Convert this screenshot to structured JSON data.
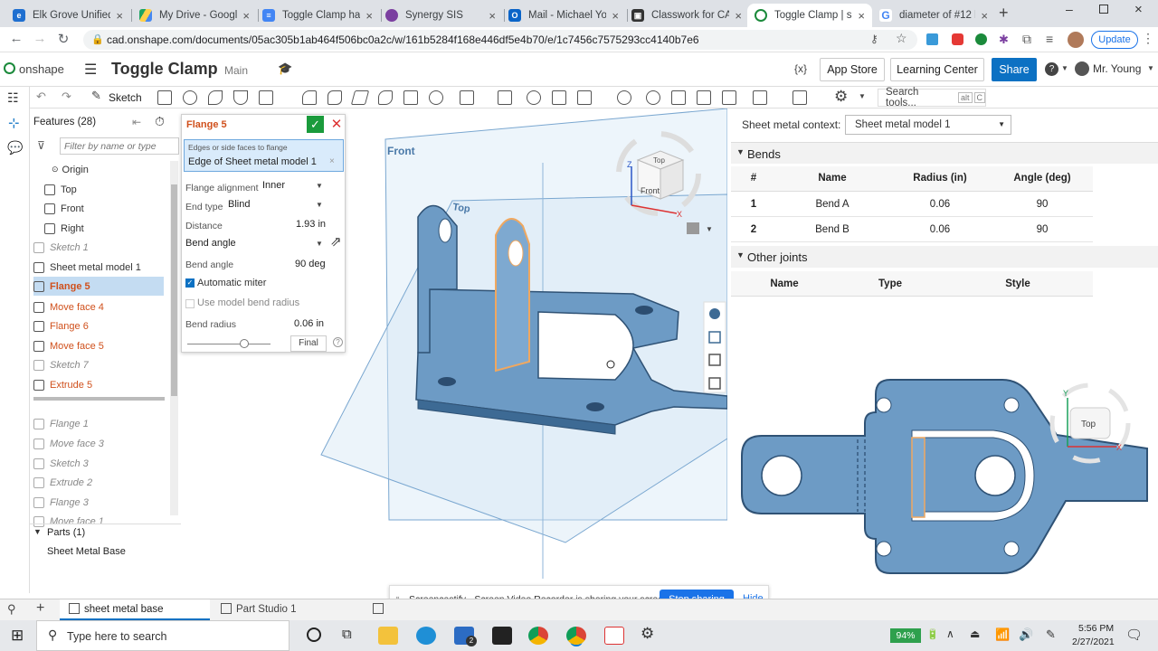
{
  "browser": {
    "tabs": [
      {
        "label": "Elk Grove Unified",
        "icon": "edge-icon"
      },
      {
        "label": "My Drive - Google",
        "icon": "drive-icon"
      },
      {
        "label": "Toggle Clamp har",
        "icon": "docs-icon"
      },
      {
        "label": "Synergy SIS",
        "icon": "synergy-icon"
      },
      {
        "label": "Mail - Michael You",
        "icon": "outlook-icon"
      },
      {
        "label": "Classwork for CAD",
        "icon": "classroom-icon"
      },
      {
        "label": "Toggle Clamp | sh",
        "icon": "onshape-icon"
      },
      {
        "label": "diameter of #12 b",
        "icon": "google-icon"
      }
    ],
    "url": "cad.onshape.com/documents/05ac305b1ab464f506bc0a2c/w/161b5284f168e446df5e4b70/e/1c7456c7575293cc4140b7e6",
    "update_label": "Update"
  },
  "app": {
    "logo": "onshape",
    "doc_title": "Toggle Clamp",
    "branch": "Main",
    "app_store": "App Store",
    "learning_center": "Learning Center",
    "share": "Share",
    "user": "Mr. Young"
  },
  "toolbar": {
    "sketch_label": "Sketch",
    "search_tools": "Search tools...",
    "search_shortcut_1": "alt",
    "search_shortcut_2": "C"
  },
  "features": {
    "header": "Features (28)",
    "filter_placeholder": "Filter by name or type",
    "items": [
      {
        "label": "Origin",
        "style": "normal"
      },
      {
        "label": "Top",
        "style": "normal"
      },
      {
        "label": "Front",
        "style": "normal"
      },
      {
        "label": "Right",
        "style": "normal"
      },
      {
        "label": "Sketch 1",
        "style": "grey"
      },
      {
        "label": "Sheet metal model 1",
        "style": "normal"
      },
      {
        "label": "Flange 5",
        "style": "selected"
      },
      {
        "label": "Move face 4",
        "style": "orange"
      },
      {
        "label": "Flange 6",
        "style": "orange"
      },
      {
        "label": "Move face 5",
        "style": "orange"
      },
      {
        "label": "Sketch 7",
        "style": "grey"
      },
      {
        "label": "Extrude 5",
        "style": "orange"
      },
      {
        "label": "Flange 1",
        "style": "rolled"
      },
      {
        "label": "Move face 3",
        "style": "rolled"
      },
      {
        "label": "Sketch 3",
        "style": "rolled"
      },
      {
        "label": "Extrude 2",
        "style": "rolled"
      },
      {
        "label": "Flange 3",
        "style": "rolled"
      },
      {
        "label": "Move face 1",
        "style": "rolled"
      }
    ],
    "parts_header": "Parts (1)",
    "part": "Sheet Metal Base"
  },
  "flange": {
    "title": "Flange 5",
    "edges_hint": "Edges or side faces to flange",
    "edges_value": "Edge of Sheet metal model 1",
    "alignment_label": "Flange alignment",
    "alignment_value": "Inner",
    "end_type_label": "End type",
    "end_type_value": "Blind",
    "distance_label": "Distance",
    "distance_value": "1.93 in",
    "bend_angle_select": "Bend angle",
    "bend_angle_label": "Bend angle",
    "bend_angle_value": "90 deg",
    "automatic_miter": "Automatic miter",
    "automatic_miter_checked": true,
    "use_model_bend_radius": "Use model bend radius",
    "use_model_bend_radius_checked": false,
    "bend_radius_label": "Bend radius",
    "bend_radius_value": "0.06 in",
    "final_label": "Final",
    "slider_position": 0.68
  },
  "viewport": {
    "plane_front": "Front",
    "plane_top": "Top",
    "cube_top": "Top",
    "cube_front": "Front",
    "axis_z": "Z",
    "axis_x": "X"
  },
  "sheet_metal": {
    "context_label": "Sheet metal context:",
    "context_value": "Sheet metal model 1",
    "bends_header": "Bends",
    "bends_columns": [
      "#",
      "Name",
      "Radius (in)",
      "Angle (deg)"
    ],
    "bends_rows": [
      [
        "1",
        "Bend A",
        "0.06",
        "90"
      ],
      [
        "2",
        "Bend B",
        "0.06",
        "90"
      ]
    ],
    "joints_header": "Other joints",
    "joints_columns": [
      "Name",
      "Type",
      "Style"
    ]
  },
  "flat_view": {
    "cube_label": "Top",
    "axis_y": "Y",
    "axis_x": "X"
  },
  "screencastify": {
    "message": "Screencastify - Screen Video Recorder is sharing your screen.",
    "stop": "Stop sharing",
    "hide": "Hide"
  },
  "bottom_tabs": {
    "tab1": "sheet metal base",
    "tab2": "Part Studio 1"
  },
  "taskbar": {
    "search_placeholder": "Type here to search",
    "battery": "94%",
    "time": "5:56 PM",
    "date": "2/27/2021",
    "mail_badge": "2"
  },
  "colors": {
    "part_blue": "#6d9bc5",
    "part_dark": "#3d6a94",
    "accent": "#0c71c3",
    "check_green": "#1a9b3c",
    "feature_orange": "#d0501c"
  }
}
